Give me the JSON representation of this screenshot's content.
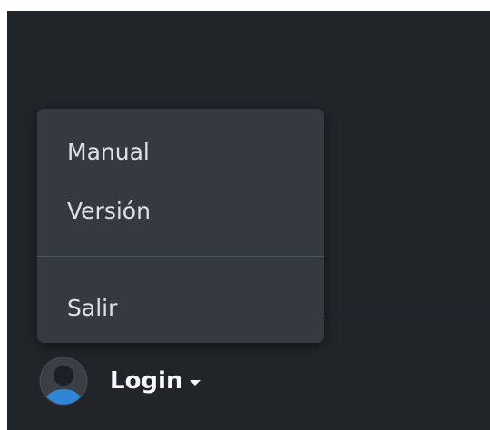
{
  "menu": {
    "items": [
      {
        "label": "Manual"
      },
      {
        "label": "Versión"
      },
      {
        "label": "Salir"
      }
    ]
  },
  "user": {
    "label": "Login",
    "avatar_icon": "user-circle-icon",
    "caret_icon": "caret-down-icon"
  },
  "colors": {
    "background": "#212529",
    "menu_background": "#343a40",
    "menu_text": "#dee2e6",
    "avatar_accent": "#2f86d6"
  }
}
